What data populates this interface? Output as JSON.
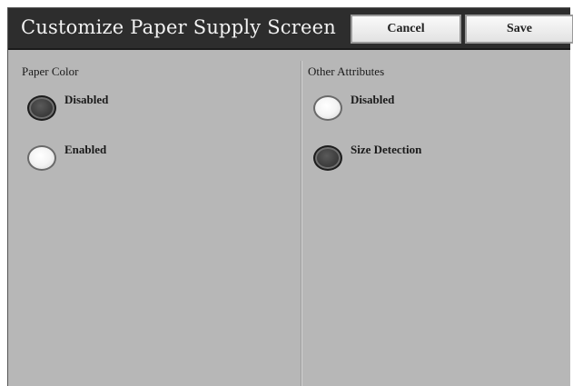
{
  "window": {
    "title": "Customize Paper Supply Screen"
  },
  "toolbar": {
    "cancel_label": "Cancel",
    "save_label": "Save"
  },
  "paper_color": {
    "label": "Paper Color",
    "options": [
      {
        "label": "Disabled",
        "selected": true
      },
      {
        "label": "Enabled",
        "selected": false
      }
    ]
  },
  "other_attributes": {
    "label": "Other Attributes",
    "options": [
      {
        "label": "Disabled",
        "selected": false
      },
      {
        "label": "Size Detection",
        "selected": true
      }
    ]
  },
  "colors": {
    "title_bar": "#2d2d2d",
    "panel": "#b7b7b7",
    "radio_selected": "#3d3d3d",
    "radio_unselected": "#f4f4f4"
  }
}
